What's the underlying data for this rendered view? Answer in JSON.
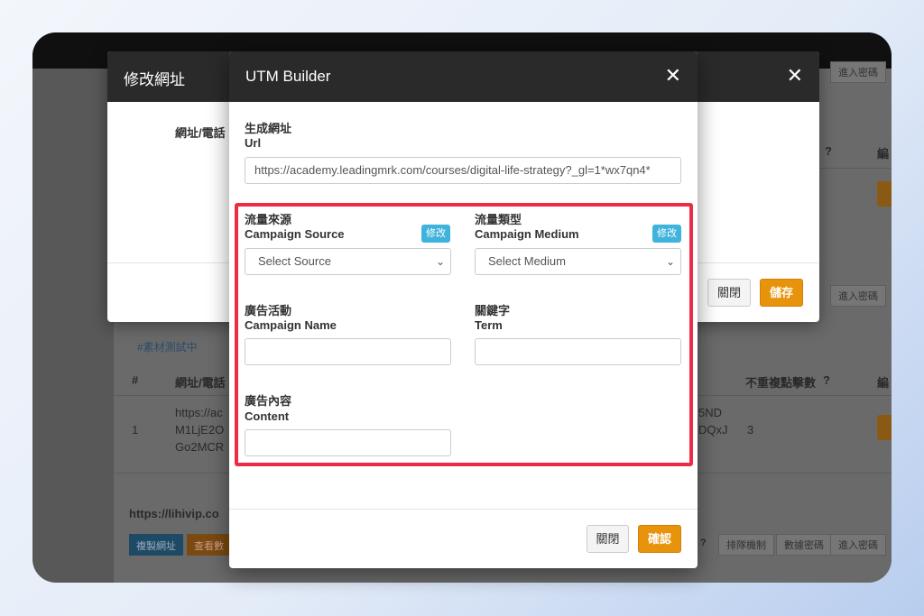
{
  "background": {
    "col_hash": "#",
    "col_url_phone": "網址/電話",
    "col_unique_clicks": "不重複點擊數",
    "col_edit_partial": "編",
    "help_icon": "question-circle-icon",
    "tag_label": "#素材測試中",
    "row_index": "1",
    "row_url_lines": [
      "https://ac",
      "M1LjE2O",
      "Go2MCR"
    ],
    "row_url_right_lines": [
      "5ND",
      "DQxJ"
    ],
    "row_clicks": "3",
    "bottom_url_partial": "https://lihivip.co",
    "copy_button": "複製網址",
    "view_data_button": "查看數",
    "top_tabs": [
      "進入密碼"
    ],
    "mid_tabs": [
      "進入密碼"
    ],
    "bottom_tabs": [
      "排隊機制",
      "數據密碼",
      "進入密碼"
    ]
  },
  "modal_edit_url": {
    "title": "修改網址",
    "field_label": "網址/電話",
    "close_button": "關閉",
    "save_button": "儲存"
  },
  "utm_builder": {
    "title": "UTM Builder",
    "url": {
      "label_zh": "生成網址",
      "label_en": "Url",
      "value": "https://academy.leadingmrk.com/courses/digital-life-strategy?_gl=1*wx7qn4*"
    },
    "source": {
      "label_zh": "流量來源",
      "label_en": "Campaign Source",
      "edit_badge": "修改",
      "selected": "Select Source"
    },
    "medium": {
      "label_zh": "流量類型",
      "label_en": "Campaign Medium",
      "edit_badge": "修改",
      "selected": "Select Medium"
    },
    "name": {
      "label_zh": "廣告活動",
      "label_en": "Campaign Name",
      "value": ""
    },
    "term": {
      "label_zh": "關鍵字",
      "label_en": "Term",
      "value": ""
    },
    "content": {
      "label_zh": "廣告內容",
      "label_en": "Content",
      "value": ""
    },
    "close_button": "關閉",
    "confirm_button": "確認",
    "highlight_color": "#ee2b45"
  }
}
